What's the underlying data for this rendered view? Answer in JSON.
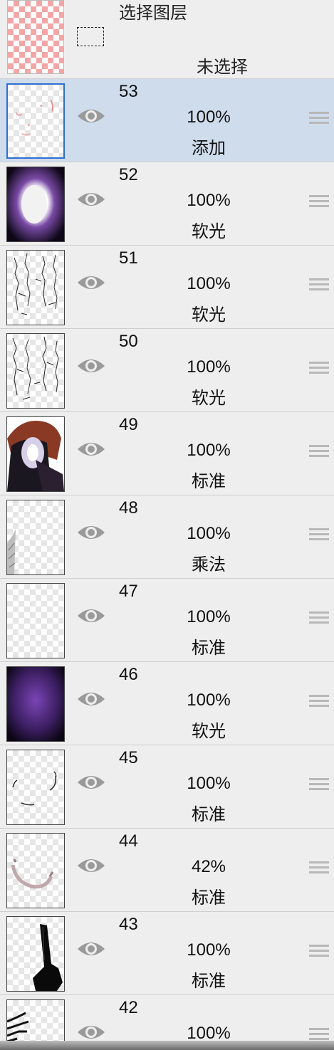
{
  "selection": {
    "title": "选择图层",
    "status": "未选择"
  },
  "layers": [
    {
      "number": "53",
      "opacity": "100%",
      "blend": "添加",
      "selected": true
    },
    {
      "number": "52",
      "opacity": "100%",
      "blend": "软光"
    },
    {
      "number": "51",
      "opacity": "100%",
      "blend": "软光"
    },
    {
      "number": "50",
      "opacity": "100%",
      "blend": "软光"
    },
    {
      "number": "49",
      "opacity": "100%",
      "blend": "标准"
    },
    {
      "number": "48",
      "opacity": "100%",
      "blend": "乘法"
    },
    {
      "number": "47",
      "opacity": "100%",
      "blend": "标准"
    },
    {
      "number": "46",
      "opacity": "100%",
      "blend": "软光"
    },
    {
      "number": "45",
      "opacity": "100%",
      "blend": "标准"
    },
    {
      "number": "44",
      "opacity": "42%",
      "blend": "标准"
    },
    {
      "number": "43",
      "opacity": "100%",
      "blend": "标准"
    },
    {
      "number": "42",
      "opacity": "100%",
      "blend": ""
    }
  ],
  "colors": {
    "selected_row": "#cfdcec",
    "selected_border": "#2f6fd0",
    "row_bg": "#eeeeee",
    "eye_icon": "#9a9a9a"
  }
}
